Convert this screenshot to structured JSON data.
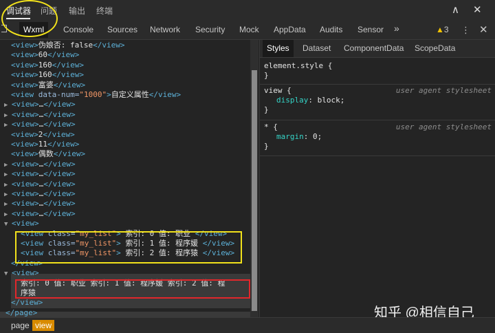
{
  "top_tabs": [
    "调试器",
    "问题",
    "输出",
    "终端"
  ],
  "tabs": [
    "Wxml",
    "Console",
    "Sources",
    "Network",
    "Security",
    "Mock",
    "AppData",
    "Audits",
    "Sensor"
  ],
  "tabs_overflow": "»",
  "warning_count": "3",
  "window_controls": {
    "collapse": "∧",
    "close": "✕"
  },
  "more_label": "⋮",
  "panel_close": "✕",
  "wxml_lines": [
    {
      "indent": 0,
      "tri": "",
      "parts": [
        [
          "tag",
          "<view>"
        ],
        [
          "txt",
          "伪娘否: false"
        ],
        [
          "tag",
          "</view>"
        ]
      ]
    },
    {
      "indent": 0,
      "tri": "",
      "parts": [
        [
          "tag",
          "<view>"
        ],
        [
          "txt",
          "60"
        ],
        [
          "tag",
          "</view>"
        ]
      ]
    },
    {
      "indent": 0,
      "tri": "",
      "parts": [
        [
          "tag",
          "<view>"
        ],
        [
          "txt",
          "160"
        ],
        [
          "tag",
          "</view>"
        ]
      ]
    },
    {
      "indent": 0,
      "tri": "",
      "parts": [
        [
          "tag",
          "<view>"
        ],
        [
          "txt",
          "160"
        ],
        [
          "tag",
          "</view>"
        ]
      ]
    },
    {
      "indent": 0,
      "tri": "",
      "parts": [
        [
          "tag",
          "<view>"
        ],
        [
          "txt",
          "富婆"
        ],
        [
          "tag",
          "</view>"
        ]
      ]
    },
    {
      "indent": 0,
      "tri": "",
      "parts": [
        [
          "tag",
          "<view "
        ],
        [
          "attr",
          " data-num="
        ],
        [
          "val",
          "\"1000\""
        ],
        [
          "tag",
          ">"
        ],
        [
          "txt",
          "自定义属性"
        ],
        [
          "tag",
          "</view>"
        ]
      ]
    },
    {
      "indent": 0,
      "tri": "▶",
      "parts": [
        [
          "tag",
          "<view>"
        ],
        [
          "txt",
          "…"
        ],
        [
          "tag",
          "</view>"
        ]
      ]
    },
    {
      "indent": 0,
      "tri": "▶",
      "parts": [
        [
          "tag",
          "<view>"
        ],
        [
          "txt",
          "…"
        ],
        [
          "tag",
          "</view>"
        ]
      ]
    },
    {
      "indent": 0,
      "tri": "▶",
      "parts": [
        [
          "tag",
          "<view>"
        ],
        [
          "txt",
          "…"
        ],
        [
          "tag",
          "</view>"
        ]
      ]
    },
    {
      "indent": 0,
      "tri": "",
      "parts": [
        [
          "tag",
          "<view>"
        ],
        [
          "txt",
          "2"
        ],
        [
          "tag",
          "</view>"
        ]
      ]
    },
    {
      "indent": 0,
      "tri": "",
      "parts": [
        [
          "tag",
          "<view>"
        ],
        [
          "txt",
          "11"
        ],
        [
          "tag",
          "</view>"
        ]
      ]
    },
    {
      "indent": 0,
      "tri": "",
      "parts": [
        [
          "tag",
          "<view>"
        ],
        [
          "txt",
          "偶数"
        ],
        [
          "tag",
          "</view>"
        ]
      ]
    },
    {
      "indent": 0,
      "tri": "▶",
      "parts": [
        [
          "tag",
          "<view>"
        ],
        [
          "txt",
          "…"
        ],
        [
          "tag",
          "</view>"
        ]
      ]
    },
    {
      "indent": 0,
      "tri": "▶",
      "parts": [
        [
          "tag",
          "<view>"
        ],
        [
          "txt",
          "…"
        ],
        [
          "tag",
          "</view>"
        ]
      ]
    },
    {
      "indent": 0,
      "tri": "▶",
      "parts": [
        [
          "tag",
          "<view>"
        ],
        [
          "txt",
          "…"
        ],
        [
          "tag",
          "</view>"
        ]
      ]
    },
    {
      "indent": 0,
      "tri": "▶",
      "parts": [
        [
          "tag",
          "<view>"
        ],
        [
          "txt",
          "…"
        ],
        [
          "tag",
          "</view>"
        ]
      ]
    },
    {
      "indent": 0,
      "tri": "▶",
      "parts": [
        [
          "tag",
          "<view>"
        ],
        [
          "txt",
          "…"
        ],
        [
          "tag",
          "</view>"
        ]
      ]
    },
    {
      "indent": 0,
      "tri": "▶",
      "parts": [
        [
          "tag",
          "<view>"
        ],
        [
          "txt",
          "…"
        ],
        [
          "tag",
          "</view>"
        ]
      ]
    },
    {
      "indent": 0,
      "tri": "▼",
      "parts": [
        [
          "tag",
          "<view>"
        ]
      ]
    },
    {
      "indent": 1,
      "tri": "",
      "parts": [
        [
          "tag",
          "<view "
        ],
        [
          "attr",
          " class="
        ],
        [
          "val",
          "\"my_list\""
        ],
        [
          "tag",
          ">"
        ],
        [
          "txt",
          " 索引: 0   值: 职业 "
        ],
        [
          "tag",
          "</view>"
        ]
      ]
    },
    {
      "indent": 1,
      "tri": "",
      "parts": [
        [
          "tag",
          "<view "
        ],
        [
          "attr",
          " class="
        ],
        [
          "val",
          "\"my_list\""
        ],
        [
          "tag",
          ">"
        ],
        [
          "txt",
          " 索引: 1   值: 程序媛 "
        ],
        [
          "tag",
          "</view>"
        ]
      ]
    },
    {
      "indent": 1,
      "tri": "",
      "parts": [
        [
          "tag",
          "<view "
        ],
        [
          "attr",
          " class="
        ],
        [
          "val",
          "\"my_list\""
        ],
        [
          "tag",
          ">"
        ],
        [
          "txt",
          " 索引: 2   值: 程序猿 "
        ],
        [
          "tag",
          "</view>"
        ]
      ]
    },
    {
      "indent": 0,
      "tri": "",
      "parts": [
        [
          "tag",
          "</view>"
        ]
      ]
    },
    {
      "indent": 0,
      "tri": "▼",
      "parts": [
        [
          "tag",
          "<view>"
        ]
      ]
    },
    {
      "indent": 1,
      "tri": "",
      "parts": [
        [
          "txt",
          "索引: 0   值: 职业 索引: 1   值: 程序媛 索引: 2   值: 程"
        ]
      ]
    },
    {
      "indent": 1,
      "tri": "",
      "parts": [
        [
          "txt",
          "序猿"
        ]
      ]
    },
    {
      "indent": 0,
      "tri": "",
      "parts": [
        [
          "tag",
          "</view>"
        ]
      ]
    },
    {
      "indent": -1,
      "tri": "",
      "parts": [
        [
          "tag",
          "</page>"
        ]
      ]
    }
  ],
  "right_tabs": [
    "Styles",
    "Dataset",
    "ComponentData",
    "ScopeData"
  ],
  "styles": {
    "element_style": "element.style {",
    "close_brace": "}",
    "rule1": {
      "selector": "view {",
      "source": "user agent stylesheet",
      "prop": "display",
      "value": "block;"
    },
    "rule2": {
      "selector": "* {",
      "source": "user agent stylesheet",
      "prop": "margin",
      "value": "0;"
    }
  },
  "breadcrumbs": [
    "page",
    "view"
  ],
  "watermark": "知乎 @相信自己"
}
